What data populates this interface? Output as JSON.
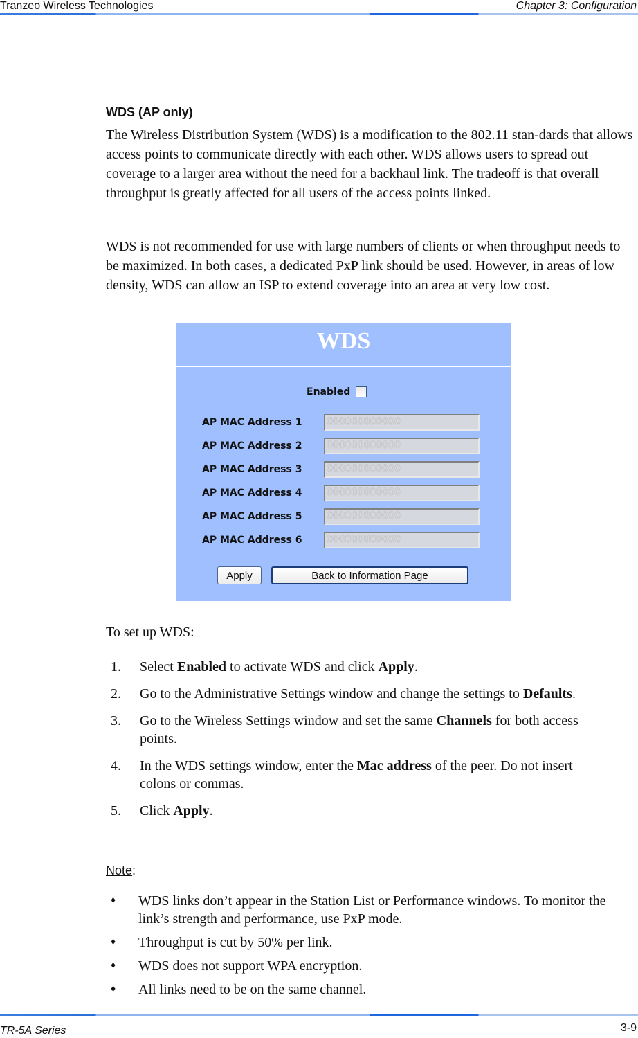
{
  "header": {
    "company": "Tranzeo Wireless Technologies",
    "chapter": "Chapter 3: Configuration"
  },
  "footer": {
    "series": "TR-5A Series",
    "page_number": "3-9"
  },
  "section": {
    "heading": "WDS (AP only)",
    "paragraph1": "The Wireless Distribution System (WDS) is a modification to the 802.11 stan-dards that allows access points to communicate directly with each other. WDS allows users to spread out coverage to a larger area without the need for a backhaul link. The tradeoff is that overall throughput is greatly affected for all users of the access points linked.",
    "paragraph2": "WDS is not recommended for use with large numbers of clients or when throughput needs to be maximized. In both cases, a dedicated PxP link should be used. However, in areas of low density, WDS can allow an ISP to extend coverage into an area at very low cost."
  },
  "wds_panel": {
    "title": "WDS",
    "enabled_label": "Enabled",
    "enabled_checked": false,
    "mac_fields": [
      {
        "label": "AP MAC Address 1",
        "value": "000000000000"
      },
      {
        "label": "AP MAC Address 2",
        "value": "000000000000"
      },
      {
        "label": "AP MAC Address 3",
        "value": "000000000000"
      },
      {
        "label": "AP MAC Address 4",
        "value": "000000000000"
      },
      {
        "label": "AP MAC Address 5",
        "value": "000000000000"
      },
      {
        "label": "AP MAC Address 6",
        "value": "000000000000"
      }
    ],
    "apply_label": "Apply",
    "back_label": "Back to Information Page",
    "colors": {
      "background": "#a0bffe",
      "title": "#ffffff"
    }
  },
  "setup": {
    "intro": "To set up WDS:",
    "steps": [
      {
        "num": "1.",
        "parts": [
          {
            "t": "Select "
          },
          {
            "b": "Enabled"
          },
          {
            "t": " to activate WDS and click "
          },
          {
            "b": "Apply"
          },
          {
            "t": "."
          }
        ]
      },
      {
        "num": "2.",
        "parts": [
          {
            "t": "Go to the Administrative Settings window and change the settings to "
          },
          {
            "b": "Defaults"
          },
          {
            "t": "."
          }
        ]
      },
      {
        "num": "3.",
        "parts": [
          {
            "t": "Go to the Wireless Settings window and set the same "
          },
          {
            "b": "Channels"
          },
          {
            "t": " for both access points."
          }
        ]
      },
      {
        "num": "4.",
        "parts": [
          {
            "t": "In the WDS settings window, enter the "
          },
          {
            "b": "Mac address"
          },
          {
            "t": " of the peer. Do not insert colons or commas."
          }
        ]
      },
      {
        "num": "5.",
        "parts": [
          {
            "t": "Click "
          },
          {
            "b": "Apply"
          },
          {
            "t": "."
          }
        ]
      }
    ]
  },
  "note": {
    "label": "Note",
    "suffix": ":",
    "bullet": "♦",
    "items": [
      "WDS links don’t appear in the Station List or Performance windows. To monitor the link’s strength and performance, use PxP mode.",
      "Throughput is cut by 50% per link.",
      "WDS does not support WPA encryption.",
      "All links need to be on the same channel."
    ]
  }
}
